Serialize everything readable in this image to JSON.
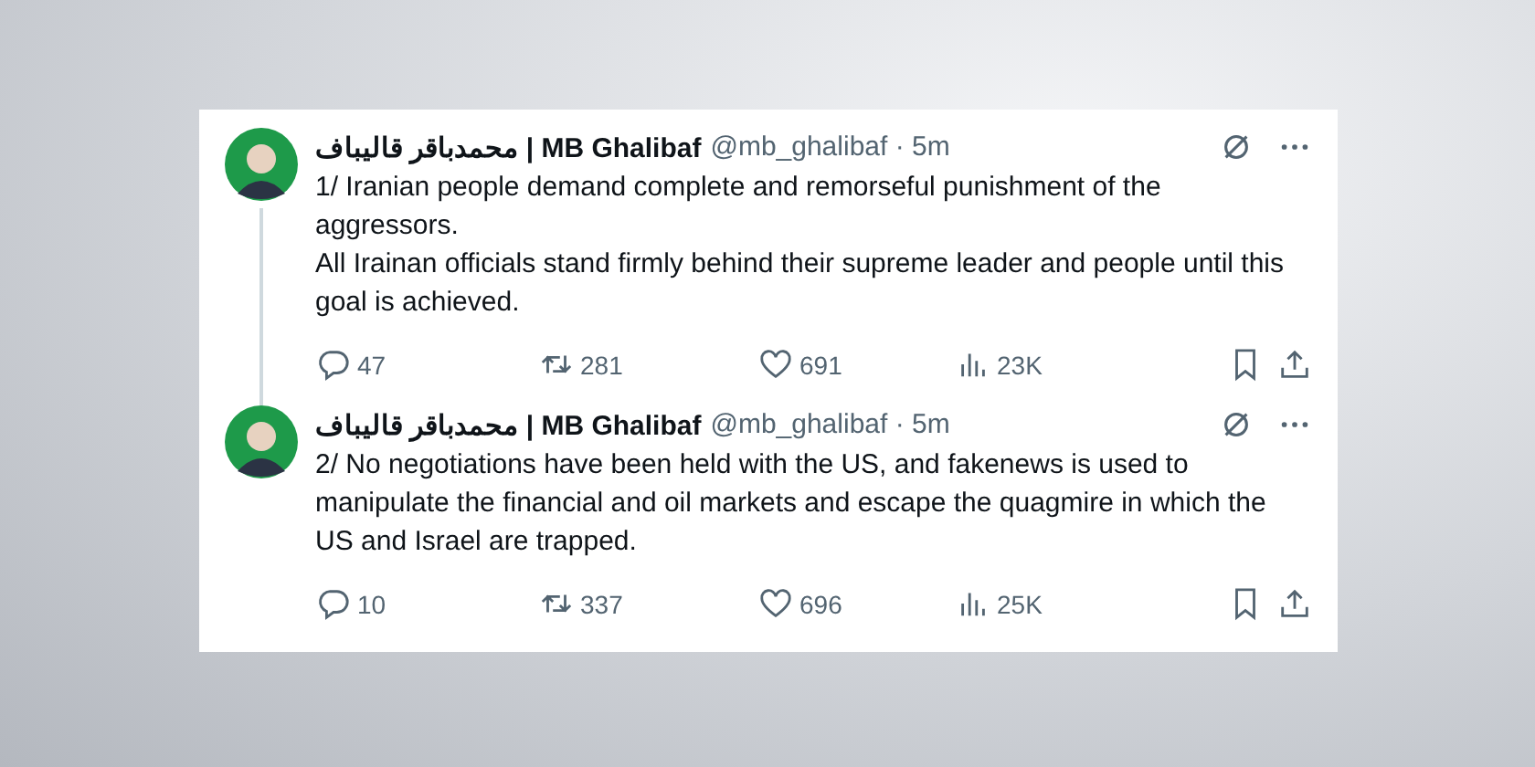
{
  "tweets": [
    {
      "author": "محمدباقر قالیباف | MB Ghalibaf",
      "handle": "@mb_ghalibaf · 5m",
      "paragraphs": [
        "1/ Iranian people demand complete and remorseful punishment of the aggressors.",
        "All Irainan officials stand firmly behind their supreme leader and people until this goal is achieved."
      ],
      "replies": "47",
      "reposts": "281",
      "likes": "691",
      "views": "23K"
    },
    {
      "author": "محمدباقر قالیباف | MB Ghalibaf",
      "handle": "@mb_ghalibaf · 5m",
      "paragraphs": [
        "2/ No negotiations have been held with the US, and fakenews is used to manipulate the financial and oil markets and escape the quagmire in which the US and Israel are trapped."
      ],
      "replies": "10",
      "reposts": "337",
      "likes": "696",
      "views": "25K"
    }
  ]
}
